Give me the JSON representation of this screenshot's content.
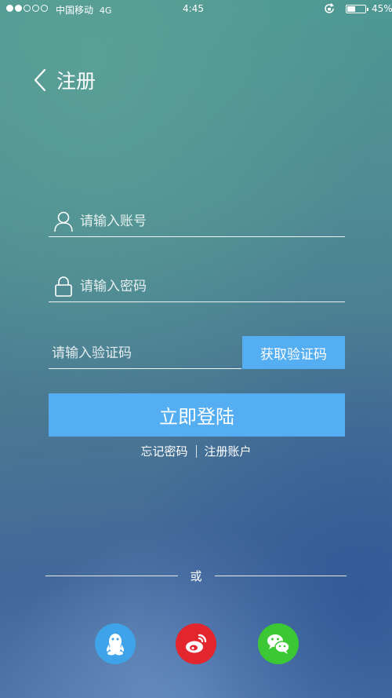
{
  "status_bar": {
    "carrier": "中国移动",
    "network": "4G",
    "time": "4:45",
    "battery_percent": "45%",
    "battery_level": 0.45,
    "signal_bars_filled": 2,
    "signal_bars_total": 5
  },
  "header": {
    "title": "注册",
    "back_icon": "chevron-left-icon"
  },
  "form": {
    "account": {
      "placeholder": "请输入账号",
      "value": "",
      "icon": "user-icon"
    },
    "password": {
      "placeholder": "请输入密码",
      "value": "",
      "icon": "lock-icon"
    },
    "code": {
      "placeholder": "请输入验证码",
      "value": ""
    },
    "get_code_label": "获取验证码",
    "login_label": "立即登陆"
  },
  "links": {
    "forgot_password": "忘记密码",
    "register_account": "注册账户"
  },
  "divider_label": "或",
  "social": {
    "qq_icon": "qq-icon",
    "weibo_icon": "weibo-icon",
    "wechat_icon": "wechat-icon"
  },
  "colors": {
    "accent": "#55aef2",
    "qq": "#3ea3e8",
    "weibo": "#e3262e",
    "wechat": "#3cc735"
  }
}
